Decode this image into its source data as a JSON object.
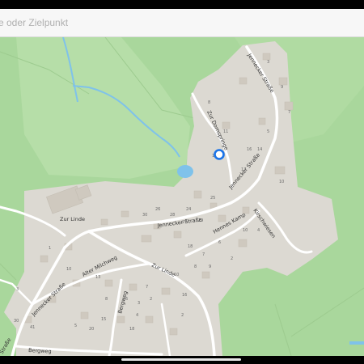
{
  "search": {
    "placeholder": "se oder Zielpunkt"
  },
  "map": {
    "colors": {
      "land": "#a9d79c",
      "forest_light": "#b6dea8",
      "residential": "#dcd9d2",
      "road": "#ffffff",
      "water": "#7fc2ea",
      "building": "#cfc9bf",
      "location_marker": "#1a73e8"
    },
    "street_labels": {
      "zur_linde_west": "Zur Linde",
      "jennecker_strasse_center": "Jennecker Straße",
      "hennes_kamp": "Hennes Kamp",
      "kirschwiesen": "Kirschwiesen",
      "alter_milchweg": "Alter Milchweg",
      "zur_linde_center": "Zur Linde",
      "jennecker_strasse_southwest": "Jennecker Straße",
      "bergweg_vertical": "Bergweg",
      "bergweg_bottom": "Bergweg",
      "strasse_edge": "Straße",
      "zur_dornspringe": "Zur Dornspringe",
      "jennecker_strasse_east": "Jennecker Straße",
      "jennecker_strasse_north": "Jennecker Straße"
    },
    "house_numbers": [
      "3",
      "9",
      "7",
      "8",
      "11",
      "14",
      "5",
      "10",
      "17",
      "12",
      "16",
      "25",
      "30",
      "26",
      "28",
      "24",
      "27",
      "29",
      "18",
      "6",
      "10",
      "4",
      "2",
      "7",
      "8",
      "9",
      "10",
      "16",
      "3",
      "30",
      "41",
      "5",
      "15",
      "20",
      "8",
      "6",
      "3",
      "2",
      "7",
      "13",
      "10",
      "4",
      "1",
      "18",
      "2"
    ],
    "location_marker_icon": "location-pin-icon"
  }
}
